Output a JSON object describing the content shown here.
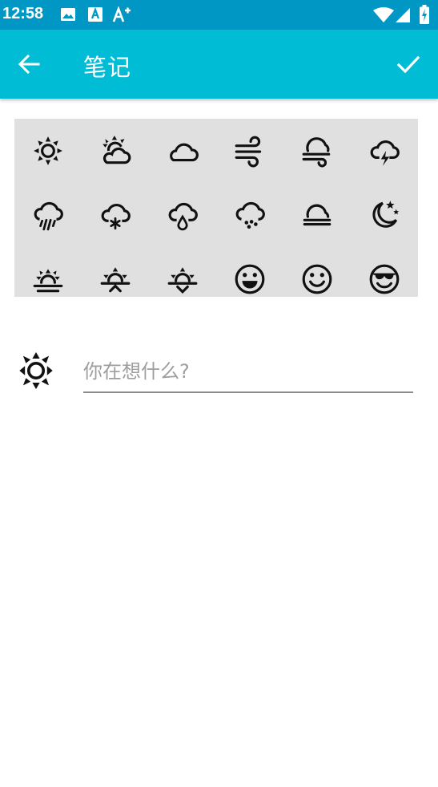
{
  "status_bar": {
    "time": "12:58",
    "icons": [
      "image-icon",
      "text-a-icon",
      "font-plus-icon",
      "wifi-icon",
      "signal-icon",
      "battery-charging-icon"
    ]
  },
  "app_bar": {
    "title": "笔记",
    "back_icon": "arrow-back-icon",
    "done_icon": "check-icon",
    "background": "#00bcd4",
    "status_background": "#0097c4"
  },
  "weather_grid": {
    "background": "#e0e0e0",
    "icons": [
      "sunny-icon",
      "partly-sunny-icon",
      "cloudy-icon",
      "windy-icon",
      "cloudy-windy-icon",
      "thunderstorm-icon",
      "rain-icon",
      "snow-icon",
      "drizzle-icon",
      "hail-icon",
      "fog-icon",
      "clear-night-icon",
      "sun-horizon-icon",
      "sunrise-icon",
      "sunset-icon",
      "grin-face-icon",
      "smile-face-icon",
      "cool-face-icon"
    ]
  },
  "editor": {
    "selected_icon": "sunny-icon",
    "placeholder": "你在想什么?",
    "value": ""
  }
}
